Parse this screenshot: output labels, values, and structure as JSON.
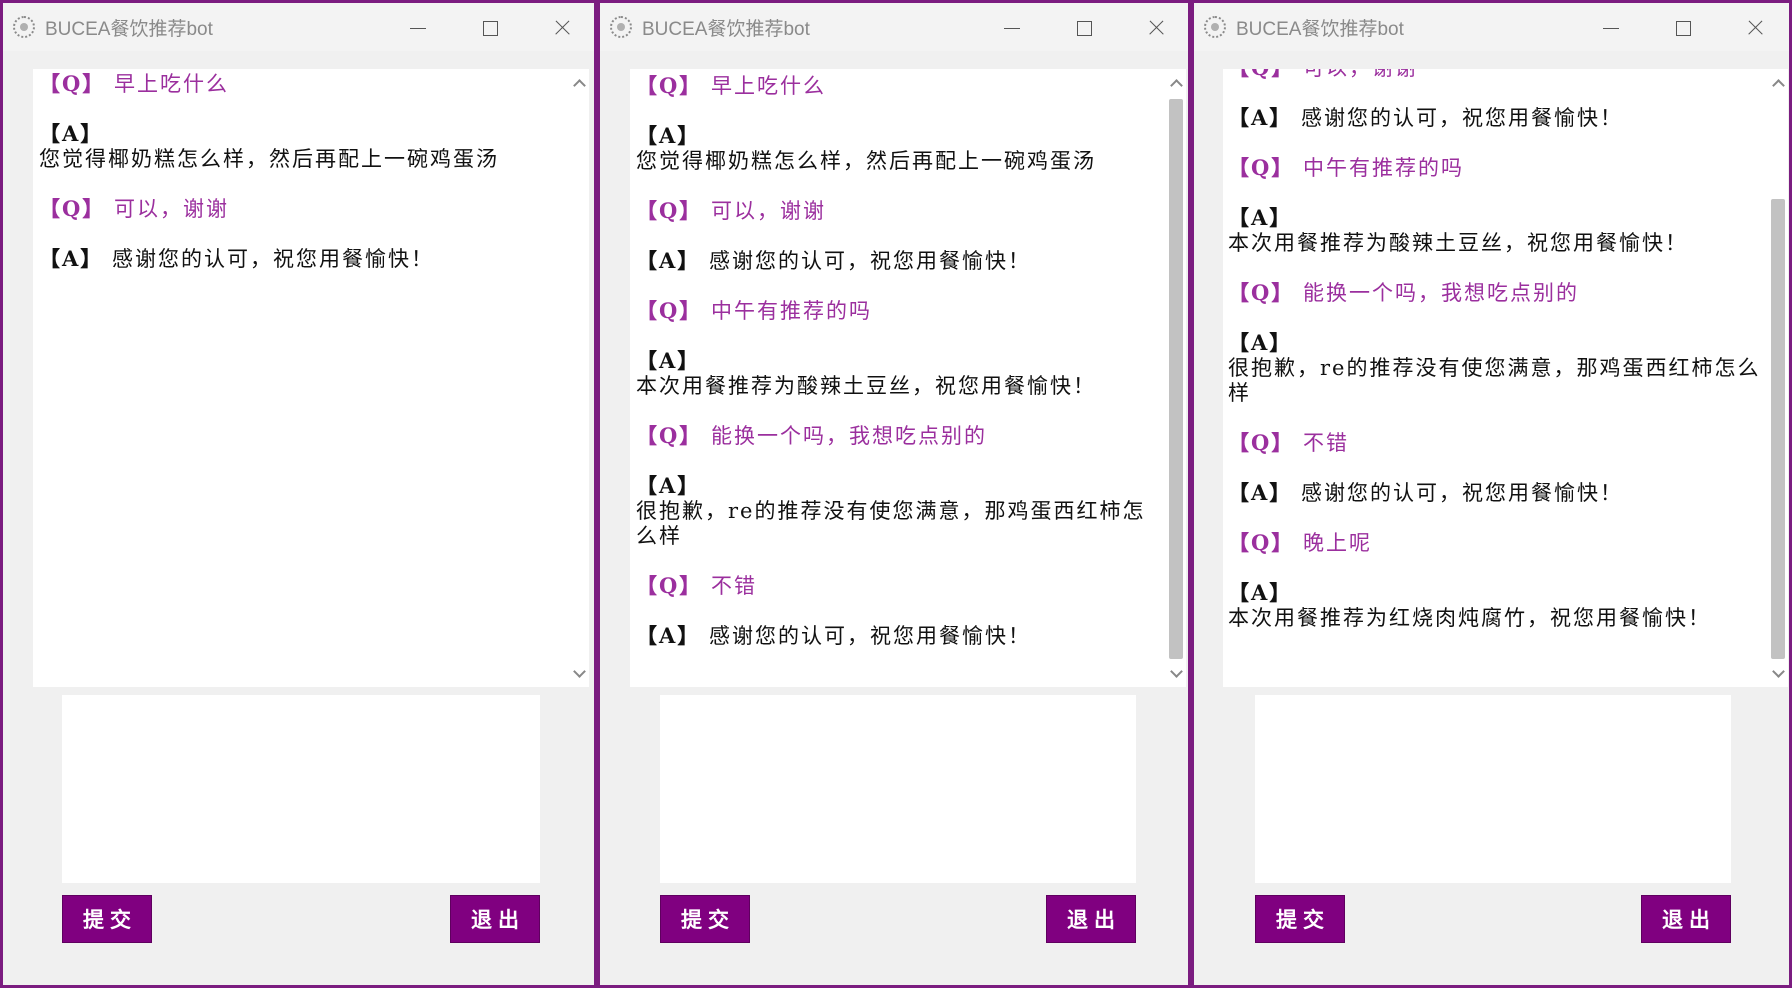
{
  "windows": [
    {
      "title": "BUCEA餐饮推荐bot",
      "messages": [
        {
          "role": "q",
          "tag": "【Q】",
          "text": "早上吃什么"
        },
        {
          "role": "a",
          "tag": "【A】",
          "text": "\n您觉得椰奶糕怎么样，然后再配上一碗鸡蛋汤"
        },
        {
          "role": "q",
          "tag": "【Q】",
          "text": "可以，谢谢"
        },
        {
          "role": "a",
          "tag": "【A】",
          "text": "感谢您的认可，祝您用餐愉快！"
        }
      ],
      "input_value": "",
      "submit_label": "提交",
      "exit_label": "退出"
    },
    {
      "title": "BUCEA餐饮推荐bot",
      "messages": [
        {
          "role": "q",
          "tag": "【Q】",
          "text": "早上吃什么"
        },
        {
          "role": "a",
          "tag": "【A】",
          "text": "\n您觉得椰奶糕怎么样，然后再配上一碗鸡蛋汤"
        },
        {
          "role": "q",
          "tag": "【Q】",
          "text": "可以，谢谢"
        },
        {
          "role": "a",
          "tag": "【A】",
          "text": "感谢您的认可，祝您用餐愉快！"
        },
        {
          "role": "q",
          "tag": "【Q】",
          "text": "中午有推荐的吗"
        },
        {
          "role": "a",
          "tag": "【A】",
          "text": "\n本次用餐推荐为酸辣土豆丝，祝您用餐愉快！"
        },
        {
          "role": "q",
          "tag": "【Q】",
          "text": "能换一个吗，我想吃点别的"
        },
        {
          "role": "a",
          "tag": "【A】",
          "text": "\n很抱歉，re的推荐没有使您满意，那鸡蛋西红柿怎么样"
        },
        {
          "role": "q",
          "tag": "【Q】",
          "text": "不错"
        },
        {
          "role": "a",
          "tag": "【A】",
          "text": "感谢您的认可，祝您用餐愉快！"
        }
      ],
      "input_value": "",
      "submit_label": "提交",
      "exit_label": "退出"
    },
    {
      "title": "BUCEA餐饮推荐bot",
      "messages": [
        {
          "role": "q",
          "tag": "【Q】",
          "text": "可以，谢谢"
        },
        {
          "role": "a",
          "tag": "【A】",
          "text": "感谢您的认可，祝您用餐愉快！"
        },
        {
          "role": "q",
          "tag": "【Q】",
          "text": "中午有推荐的吗"
        },
        {
          "role": "a",
          "tag": "【A】",
          "text": "\n本次用餐推荐为酸辣土豆丝，祝您用餐愉快！"
        },
        {
          "role": "q",
          "tag": "【Q】",
          "text": "能换一个吗，我想吃点别的"
        },
        {
          "role": "a",
          "tag": "【A】",
          "text": "\n很抱歉，re的推荐没有使您满意，那鸡蛋西红柿怎么样"
        },
        {
          "role": "q",
          "tag": "【Q】",
          "text": "不错"
        },
        {
          "role": "a",
          "tag": "【A】",
          "text": "感谢您的认可，祝您用餐愉快！"
        },
        {
          "role": "q",
          "tag": "【Q】",
          "text": "晚上呢"
        },
        {
          "role": "a",
          "tag": "【A】",
          "text": "\n本次用餐推荐为红烧肉炖腐竹，祝您用餐愉快！"
        }
      ],
      "input_value": "",
      "submit_label": "提交",
      "exit_label": "退出"
    }
  ],
  "colors": {
    "window_border": "#7b1c80",
    "button_bg": "#800080",
    "question_text": "#9b2f9e",
    "answer_text": "#111111"
  }
}
